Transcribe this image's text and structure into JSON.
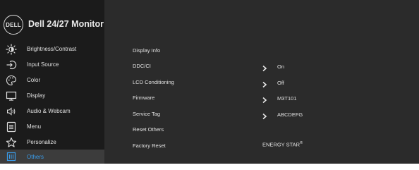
{
  "header": {
    "logo_text": "DELL",
    "title": "Dell 24/27 Monitor"
  },
  "menu": [
    {
      "label": "Brightness/Contrast",
      "icon": "brightness-icon"
    },
    {
      "label": "Input Source",
      "icon": "input-source-icon"
    },
    {
      "label": "Color",
      "icon": "color-palette-icon"
    },
    {
      "label": "Display",
      "icon": "display-monitor-icon"
    },
    {
      "label": "Audio & Webcam",
      "icon": "speaker-icon"
    },
    {
      "label": "Menu",
      "icon": "menu-list-icon"
    },
    {
      "label": "Personalize",
      "icon": "star-icon"
    },
    {
      "label": "Others",
      "icon": "others-icon",
      "active": true
    }
  ],
  "others": [
    {
      "label": "Display Info",
      "value": ""
    },
    {
      "label": "DDC/CI",
      "value": "On"
    },
    {
      "label": "LCD Conditioning",
      "value": "Off"
    },
    {
      "label": "Firmware",
      "value": "M3T101"
    },
    {
      "label": "Service Tag",
      "value": "ABCDEFG"
    },
    {
      "label": "Reset Others",
      "value": ""
    },
    {
      "label": "Factory Reset",
      "value": "ENERGY STAR",
      "value_sup": "®"
    }
  ],
  "colors": {
    "accent": "#3a9be8",
    "panel": "#2b2b2b",
    "sidebar": "#1b1b1b"
  }
}
